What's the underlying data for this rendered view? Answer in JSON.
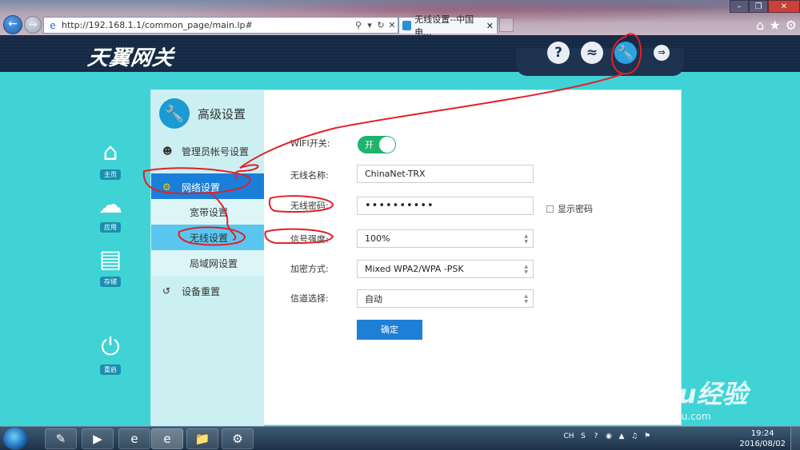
{
  "browser": {
    "url": "http://192.168.1.1/common_page/main.lp#",
    "tab_title": "无线设置--中国电...",
    "address_icons": [
      "search-icon",
      "dropdown-icon",
      "refresh-icon",
      "stop-icon"
    ]
  },
  "header": {
    "logo": "天翼网关",
    "icons": [
      "help-icon",
      "status-icon",
      "settings-icon",
      "logout-icon"
    ]
  },
  "left_nav": {
    "home": "主页",
    "app": "应用",
    "storage": "存储",
    "reboot": "重启"
  },
  "side_menu": {
    "title": "高级设置",
    "admin": "管理员帐号设置",
    "network": "网络设置",
    "broadband": "宽带设置",
    "wireless": "无线设置",
    "lan": "局域网设置",
    "reset": "设备重置"
  },
  "form": {
    "wifi_switch_label": "WIFI开关:",
    "wifi_switch_state": "开",
    "ssid_label": "无线名称:",
    "ssid_value": "ChinaNet-TRX",
    "password_label": "无线密码:",
    "password_value": "••••••••••",
    "show_password_label": "显示密码",
    "signal_label": "信号强度:",
    "signal_value": "100%",
    "encryption_label": "加密方式:",
    "encryption_value": "Mixed WPA2/WPA -PSK",
    "channel_label": "信道选择:",
    "channel_value": "自动",
    "submit_label": "确定"
  },
  "watermark": {
    "main": "Baidu经验",
    "sub": "jingyan.baidu.com"
  },
  "taskbar": {
    "ime": "CH",
    "time": "19:24",
    "date": "2016/08/02"
  },
  "colors": {
    "page_background": "#3fd3d6",
    "header": "#152844",
    "accent_blue": "#1a7fd8",
    "toggle_on": "#1fb36b",
    "annotation_red": "#e0202a"
  }
}
